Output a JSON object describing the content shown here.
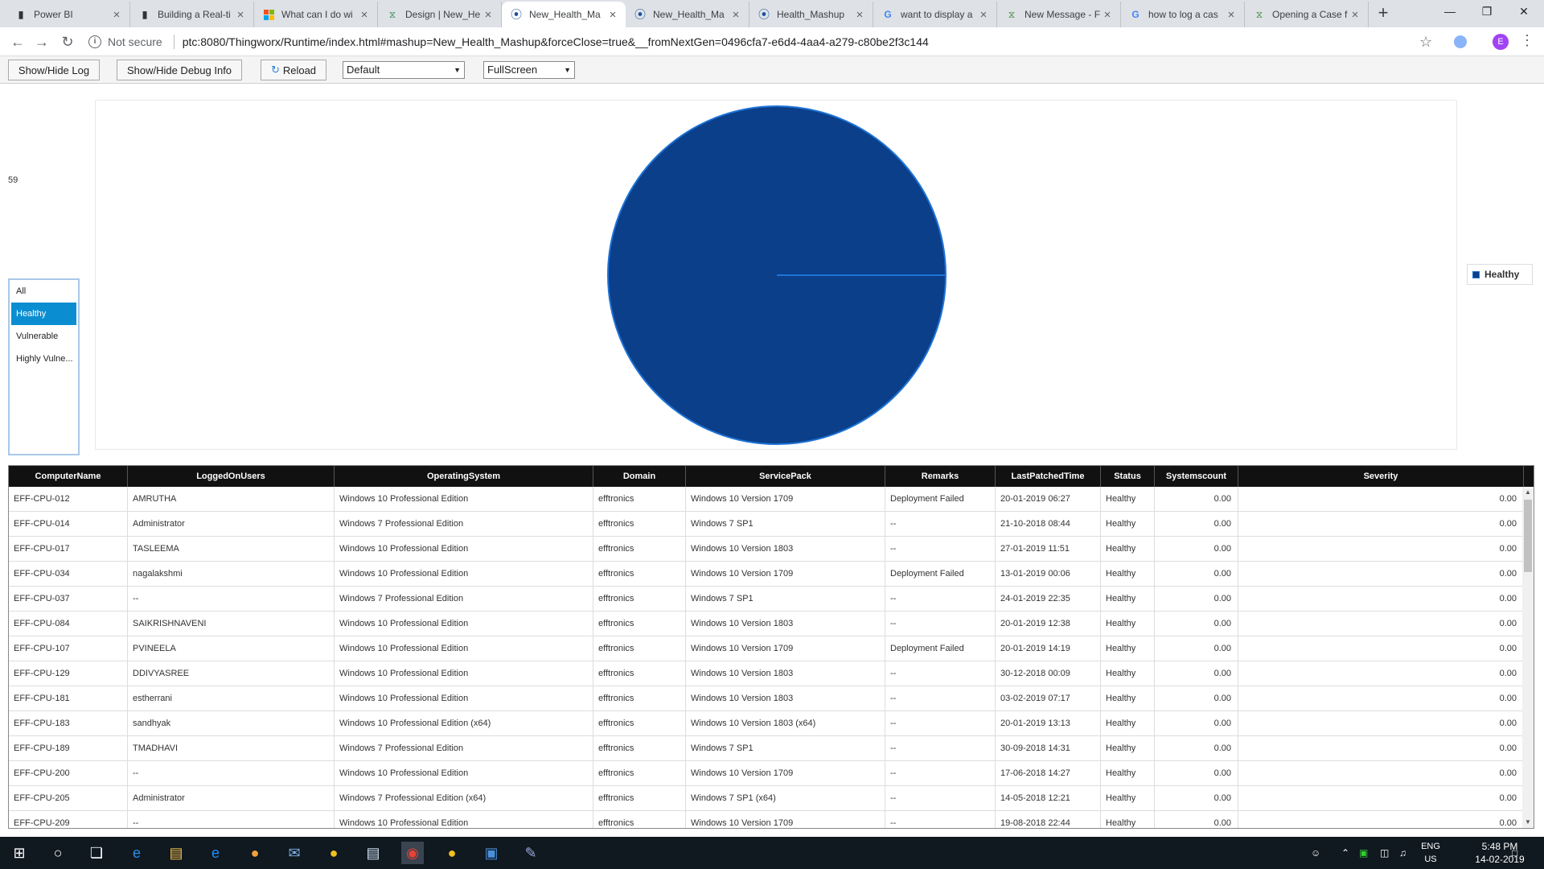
{
  "browser": {
    "tabs": [
      {
        "title": "Power BI",
        "icon": "power-bi-icon"
      },
      {
        "title": "Building a Real-ti",
        "icon": "power-bi-icon"
      },
      {
        "title": "What can I do wi",
        "icon": "microsoft-icon"
      },
      {
        "title": "Design | New_He",
        "icon": "thingworx-icon"
      },
      {
        "title": "New_Health_Ma",
        "icon": "thingworx-runtime-icon",
        "active": true
      },
      {
        "title": "New_Health_Ma",
        "icon": "thingworx-runtime-icon"
      },
      {
        "title": "Health_Mashup",
        "icon": "thingworx-runtime-icon"
      },
      {
        "title": "want to display a",
        "icon": "google-icon"
      },
      {
        "title": "New Message - F",
        "icon": "ptc-community-icon"
      },
      {
        "title": "how to log a cas",
        "icon": "google-icon"
      },
      {
        "title": "Opening a Case f",
        "icon": "ptc-community-icon"
      }
    ],
    "security_label": "Not secure",
    "url": "ptc:8080/Thingworx/Runtime/index.html#mashup=New_Health_Mashup&forceClose=true&__fromNextGen=0496cfa7-e6d4-4aa4-a279-c80be2f3c144",
    "profile_initial": "E"
  },
  "runtime_toolbar": {
    "show_hide_log": "Show/Hide Log",
    "show_hide_debug": "Show/Hide Debug Info",
    "reload": "Reload",
    "theme_select": "Default",
    "mode_select": "FullScreen"
  },
  "mashup": {
    "count_value": "59",
    "filter": {
      "items": [
        "All",
        "Healthy",
        "Vulnerable",
        "Highly Vulne..."
      ],
      "selected": "Healthy"
    },
    "chart_data": {
      "type": "pie",
      "slices": [
        {
          "label": "Healthy",
          "value": 59,
          "color": "#0b3f8a"
        }
      ],
      "legend": [
        "Healthy"
      ],
      "legend_position": "right"
    },
    "grid": {
      "columns": [
        "ComputerName",
        "LoggedOnUsers",
        "OperatingSystem",
        "Domain",
        "ServicePack",
        "Remarks",
        "LastPatchedTime",
        "Status",
        "Systemscount",
        "Severity"
      ],
      "rows": [
        [
          "EFF-CPU-012",
          "AMRUTHA",
          "Windows 10 Professional Edition",
          "efftronics",
          "Windows 10 Version 1709",
          "Deployment Failed",
          "20-01-2019 06:27",
          "Healthy",
          "0.00",
          "0.00"
        ],
        [
          "EFF-CPU-014",
          "Administrator",
          "Windows 7 Professional Edition",
          "efftronics",
          "Windows 7 SP1",
          "--",
          "21-10-2018 08:44",
          "Healthy",
          "0.00",
          "0.00"
        ],
        [
          "EFF-CPU-017",
          "TASLEEMA",
          "Windows 10 Professional Edition",
          "efftronics",
          "Windows 10 Version 1803",
          "--",
          "27-01-2019 11:51",
          "Healthy",
          "0.00",
          "0.00"
        ],
        [
          "EFF-CPU-034",
          "nagalakshmi",
          "Windows 10 Professional Edition",
          "efftronics",
          "Windows 10 Version 1709",
          "Deployment Failed",
          "13-01-2019 00:06",
          "Healthy",
          "0.00",
          "0.00"
        ],
        [
          "EFF-CPU-037",
          "--",
          "Windows 7 Professional Edition",
          "efftronics",
          "Windows 7 SP1",
          "--",
          "24-01-2019 22:35",
          "Healthy",
          "0.00",
          "0.00"
        ],
        [
          "EFF-CPU-084",
          "SAIKRISHNAVENI",
          "Windows 10 Professional Edition",
          "efftronics",
          "Windows 10 Version 1803",
          "--",
          "20-01-2019 12:38",
          "Healthy",
          "0.00",
          "0.00"
        ],
        [
          "EFF-CPU-107",
          "PVINEELA",
          "Windows 10 Professional Edition",
          "efftronics",
          "Windows 10 Version 1709",
          "Deployment Failed",
          "20-01-2019 14:19",
          "Healthy",
          "0.00",
          "0.00"
        ],
        [
          "EFF-CPU-129",
          "DDIVYASREE",
          "Windows 10 Professional Edition",
          "efftronics",
          "Windows 10 Version 1803",
          "--",
          "30-12-2018 00:09",
          "Healthy",
          "0.00",
          "0.00"
        ],
        [
          "EFF-CPU-181",
          "estherrani",
          "Windows 10 Professional Edition",
          "efftronics",
          "Windows 10 Version 1803",
          "--",
          "03-02-2019 07:17",
          "Healthy",
          "0.00",
          "0.00"
        ],
        [
          "EFF-CPU-183",
          "sandhyak",
          "Windows 10 Professional Edition (x64)",
          "efftronics",
          "Windows 10 Version 1803 (x64)",
          "--",
          "20-01-2019 13:13",
          "Healthy",
          "0.00",
          "0.00"
        ],
        [
          "EFF-CPU-189",
          "TMADHAVI",
          "Windows 7 Professional Edition",
          "efftronics",
          "Windows 7 SP1",
          "--",
          "30-09-2018 14:31",
          "Healthy",
          "0.00",
          "0.00"
        ],
        [
          "EFF-CPU-200",
          "--",
          "Windows 10 Professional Edition",
          "efftronics",
          "Windows 10 Version 1709",
          "--",
          "17-06-2018 14:27",
          "Healthy",
          "0.00",
          "0.00"
        ],
        [
          "EFF-CPU-205",
          "Administrator",
          "Windows 7 Professional Edition (x64)",
          "efftronics",
          "Windows 7 SP1 (x64)",
          "--",
          "14-05-2018 12:21",
          "Healthy",
          "0.00",
          "0.00"
        ],
        [
          "EFF-CPU-209",
          "--",
          "Windows 10 Professional Edition",
          "efftronics",
          "Windows 10 Version 1709",
          "--",
          "19-08-2018 22:44",
          "Healthy",
          "0.00",
          "0.00"
        ]
      ]
    }
  },
  "taskbar": {
    "lang_top": "ENG",
    "lang_bottom": "US",
    "time": "5:48 PM",
    "date": "14-02-2019"
  }
}
